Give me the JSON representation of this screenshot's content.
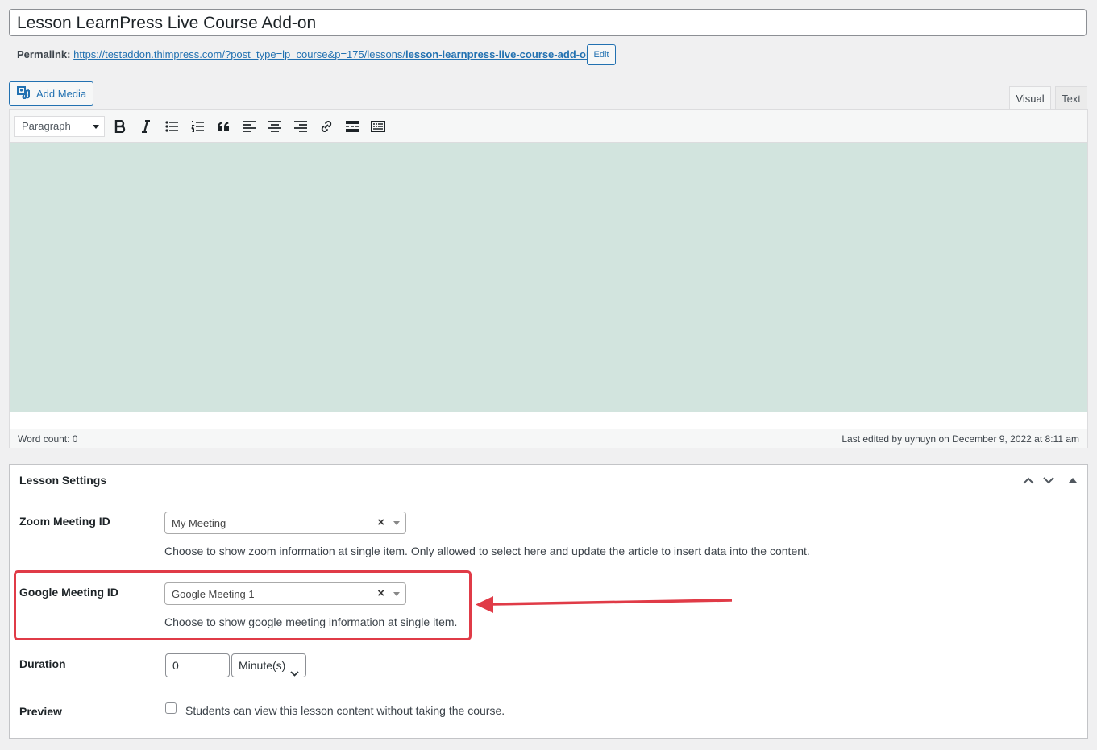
{
  "post": {
    "title": "Lesson LearnPress Live Course Add-on",
    "permalink_label": "Permalink:",
    "permalink_base": "https://testaddon.thimpress.com/?post_type=lp_course&p=175/lessons/",
    "permalink_slug": "lesson-learnpress-live-course-add-on/",
    "edit_label": "Edit"
  },
  "editor": {
    "add_media_label": "Add Media",
    "tabs": {
      "visual": "Visual",
      "text": "Text"
    },
    "format_value": "Paragraph",
    "toolbar_icons": [
      "bold-icon",
      "italic-icon",
      "bullet-list-icon",
      "numbered-list-icon",
      "blockquote-icon",
      "align-left-icon",
      "align-center-icon",
      "align-right-icon",
      "link-icon",
      "read-more-icon",
      "toolbar-toggle-icon"
    ],
    "content_bg": "#d2e4de",
    "word_count": "Word count: 0",
    "last_edited": "Last edited by uynuyn on December 9, 2022 at 8:11 am"
  },
  "settings": {
    "title": "Lesson Settings",
    "zoom": {
      "label": "Zoom Meeting ID",
      "value": "My Meeting",
      "description": "Choose to show zoom information at single item. Only allowed to select here and update the article to insert data into the content."
    },
    "google": {
      "label": "Google Meeting ID",
      "value": "Google Meeting 1",
      "description": "Choose to show google meeting information at single item."
    },
    "duration": {
      "label": "Duration",
      "value": "0",
      "unit": "Minute(s)"
    },
    "preview": {
      "label": "Preview",
      "checkbox_label": "Students can view this lesson content without taking the course.",
      "checked": false
    }
  },
  "annotation": {
    "color": "#e03b47"
  }
}
